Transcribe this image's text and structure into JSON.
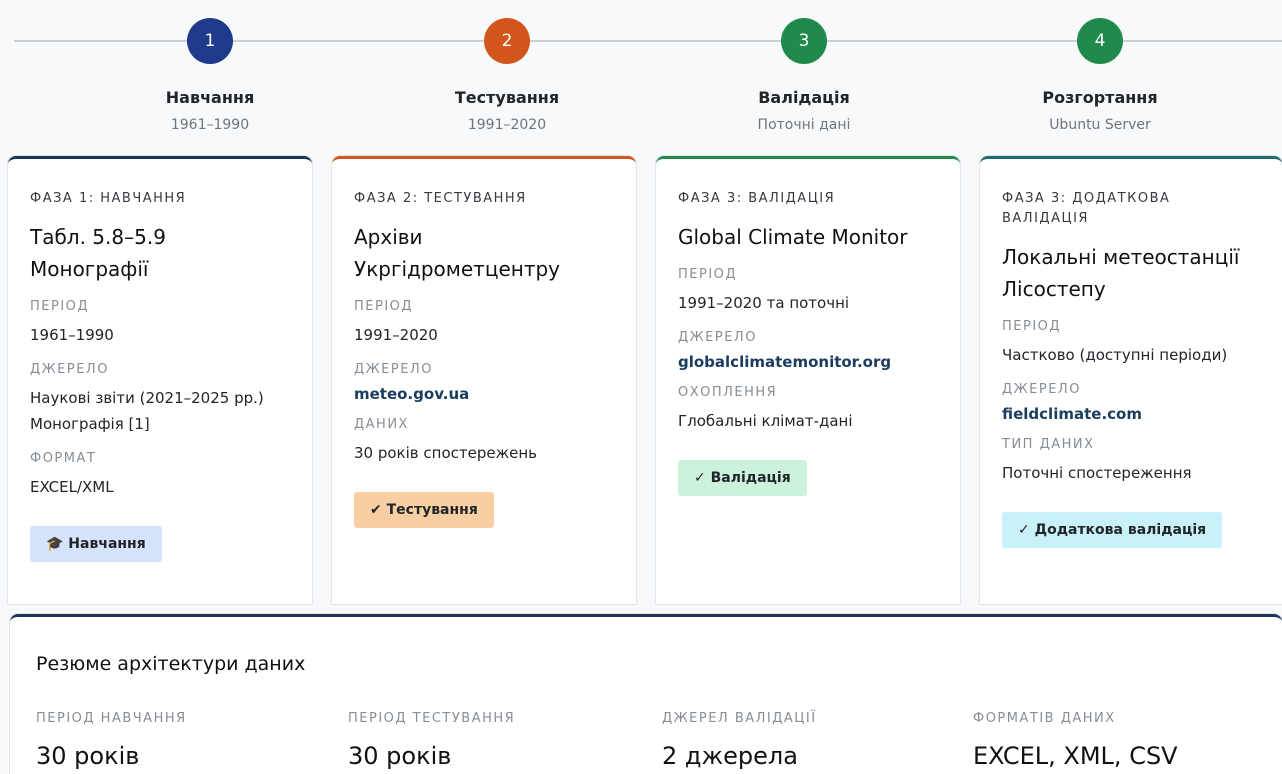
{
  "timeline": [
    {
      "number": "1",
      "title": "Навчання",
      "subtitle": "1961–1990",
      "color": "#1f3a8a"
    },
    {
      "number": "2",
      "title": "Тестування",
      "subtitle": "1991–2020",
      "color": "#d2561b"
    },
    {
      "number": "3",
      "title": "Валідація",
      "subtitle": "Поточні дані",
      "color": "#1f8a4c"
    },
    {
      "number": "4",
      "title": "Розгортання",
      "subtitle": "Ubuntu Server",
      "color": "#1f8a4c"
    }
  ],
  "cards": [
    {
      "phase": "ФАЗА 1: НАВЧАННЯ",
      "title": "Табл. 5.8–5.9 Монографії",
      "f1_label": "ПЕРІОД",
      "f1_value": "1961–1990",
      "f2_label": "ДЖЕРЕЛО",
      "f2_value": "Наукові звіти (2021–2025 рр.) Монографія [1]",
      "f3_label": "ФОРМАТ",
      "f3_value": "EXCEL/XML",
      "badge": "🎓 Навчання",
      "badge_color": "#d6e4fb",
      "border_color": "#1a365d"
    },
    {
      "phase": "ФАЗА 2: ТЕСТУВАННЯ",
      "title": "Архіви Укргідрометцентру",
      "f1_label": "ПЕРІОД",
      "f1_value": "1991–2020",
      "f2_label": "ДЖЕРЕЛО",
      "f2_value": "meteo.gov.ua",
      "f3_label": "ДАНИХ",
      "f3_value": "30 років спостережень",
      "badge": "✔ Тестування",
      "badge_color": "#f8cfa2",
      "border_color": "#d2561b"
    },
    {
      "phase": "ФАЗА 3: ВАЛІДАЦІЯ",
      "title": "Global Climate Monitor",
      "f1_label": "ПЕРІОД",
      "f1_value": "1991–2020 та поточні",
      "f2_label": "ДЖЕРЕЛО",
      "f2_value": "globalclimatemonitor.org",
      "f3_label": "ОХОПЛЕННЯ",
      "f3_value": "Глобальні клімат-дані",
      "badge": "✓ Валідація",
      "badge_color": "#cdf2dc",
      "border_color": "#1f8a4c"
    },
    {
      "phase": "ФАЗА 3: ДОДАТКОВА ВАЛІДАЦІЯ",
      "title": "Локальні метеостанції Лісостепу",
      "f1_label": "ПЕРІОД",
      "f1_value": "Частково (доступні періоди)",
      "f2_label": "ДЖЕРЕЛО",
      "f2_value": "fieldclimate.com",
      "f3_label": "ТИП ДАНИХ",
      "f3_value": "Поточні спостереження",
      "badge": "✓ Додаткова валідація",
      "badge_color": "#c8f1f9",
      "border_color": "#1f6b6b"
    }
  ],
  "summary": {
    "title": "Резюме архітектури даних",
    "stats": [
      {
        "label": "ПЕРІОД НАВЧАННЯ",
        "value": "30 років"
      },
      {
        "label": "ПЕРІОД ТЕСТУВАННЯ",
        "value": "30 років"
      },
      {
        "label": "ДЖЕРЕЛ ВАЛІДАЦІЇ",
        "value": "2 джерела"
      },
      {
        "label": "ФОРМАТІВ ДАНИХ",
        "value": "EXCEL, XML, CSV"
      }
    ]
  }
}
